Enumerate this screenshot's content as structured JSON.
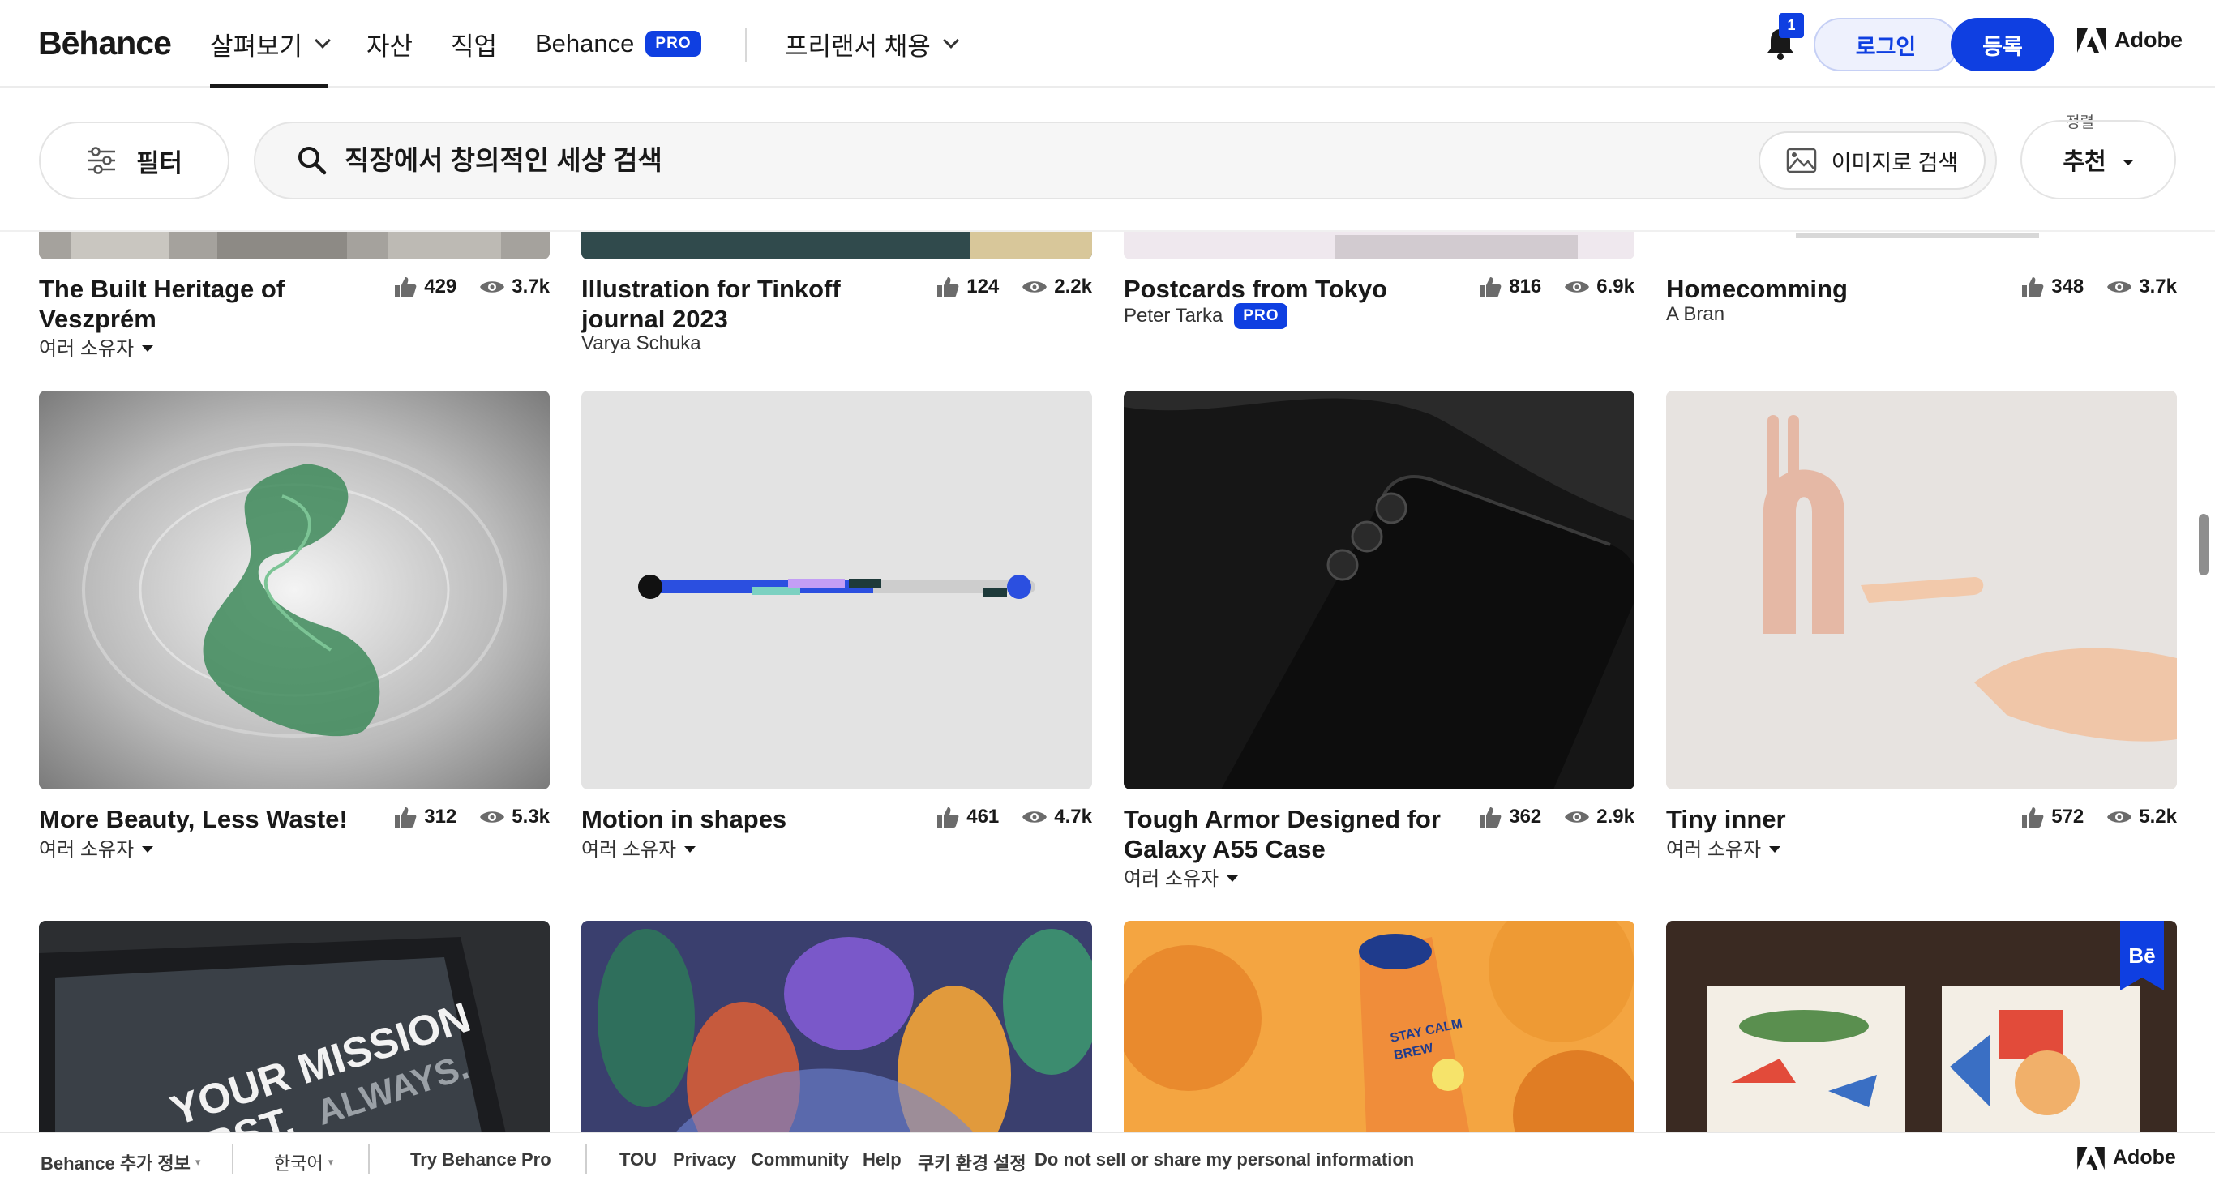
{
  "nav": {
    "logo": "Bēhance",
    "explore": "살펴보기",
    "assets": "자산",
    "jobs": "직업",
    "behance_pro": "Behance",
    "pro_badge": "PRO",
    "hire_freelancers": "프리랜서 채용",
    "notification_count": "1",
    "login": "로그인",
    "signup": "등록",
    "adobe": "Adobe"
  },
  "searchbar": {
    "filter": "필터",
    "placeholder": "직장에서 창의적인 세상 검색",
    "image_search": "이미지로 검색",
    "sort_label": "정렬",
    "sort_value": "추천"
  },
  "cards": [
    {
      "title": "The Built Heritage of Veszprém",
      "owner": "여러 소유자",
      "multi": true,
      "likes": "429",
      "views": "3.7k"
    },
    {
      "title": "Illustration for Tinkoff journal 2023",
      "owner": "Varya Schuka",
      "multi": false,
      "likes": "124",
      "views": "2.2k"
    },
    {
      "title": "Postcards from Tokyo",
      "owner": "Peter Tarka",
      "multi": false,
      "pro": "PRO",
      "likes": "816",
      "views": "6.9k"
    },
    {
      "title": "Homecomming",
      "owner": "A Bran",
      "multi": false,
      "likes": "348",
      "views": "3.7k"
    },
    {
      "title": "More Beauty, Less Waste!",
      "owner": "여러 소유자",
      "multi": true,
      "likes": "312",
      "views": "5.3k"
    },
    {
      "title": "Motion in shapes",
      "owner": "여러 소유자",
      "multi": true,
      "likes": "461",
      "views": "4.7k"
    },
    {
      "title": "Tough Armor Designed for Galaxy A55 Case",
      "owner": "여러 소유자",
      "multi": true,
      "likes": "362",
      "views": "2.9k"
    },
    {
      "title": "Tiny inner",
      "owner": "여러 소유자",
      "multi": true,
      "likes": "572",
      "views": "5.2k"
    }
  ],
  "thumb_text": {
    "mission": "YOUR MISSION",
    "first": "FIRST.",
    "always": "ALWAYS.",
    "be_badge": "Bē",
    "can_label": "STAY CALM",
    "can_label2": "BREW"
  },
  "footer": {
    "more_info": "Behance 추가 정보",
    "language": "한국어",
    "try_pro": "Try Behance Pro",
    "tou": "TOU",
    "privacy": "Privacy",
    "community": "Community",
    "help": "Help",
    "cookies": "쿠키 환경 설정",
    "do_not_sell": "Do not sell or share my personal information",
    "adobe": "Adobe"
  }
}
